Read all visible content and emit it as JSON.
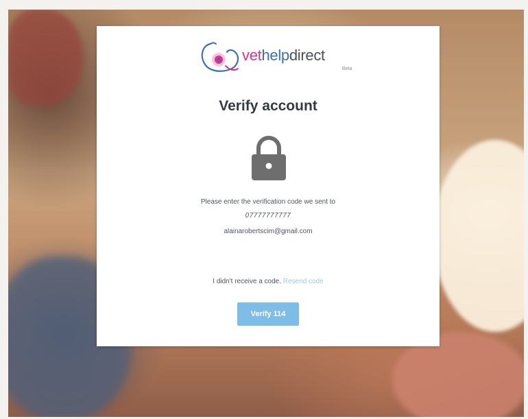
{
  "brand": {
    "part1": "vet",
    "part2": "help",
    "part3": "direct",
    "badge": "Beta",
    "colors": {
      "pink": "#e0318a",
      "blue": "#3a6fb6",
      "gray": "#4a4f5c"
    }
  },
  "page": {
    "title": "Verify account",
    "icon": "lock-icon"
  },
  "message": {
    "line1": "Please enter the verification code we sent to",
    "phone": "07777777777",
    "email": "alainarobertscim@gmail.com"
  },
  "resend": {
    "prompt": "I didn't receive a code.",
    "link": "Resend code"
  },
  "actions": {
    "verify_label": "Verify 114",
    "accent": "#7fbde9"
  }
}
